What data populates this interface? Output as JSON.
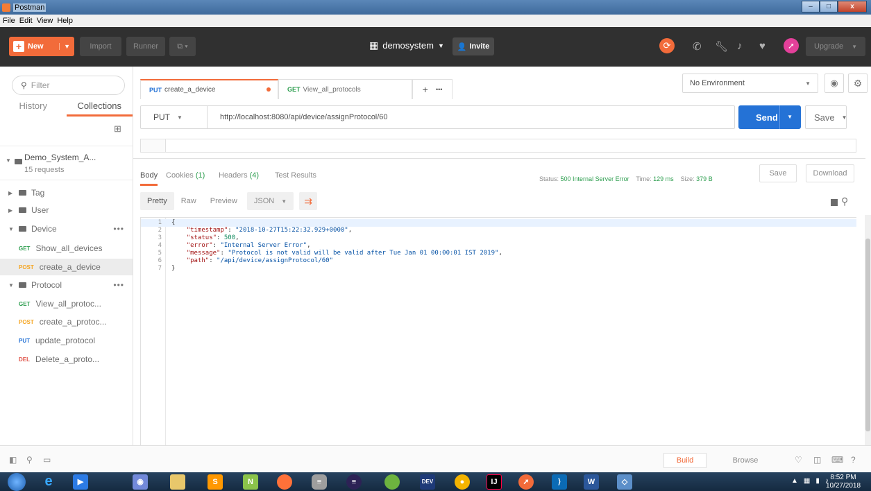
{
  "window": {
    "title": "Postman",
    "minimize": "–",
    "maximize": "□",
    "close": "x"
  },
  "menu": [
    "File",
    "Edit",
    "View",
    "Help"
  ],
  "header": {
    "new_label": "New",
    "import_label": "Import",
    "runner_label": "Runner",
    "workspace_label": "demosystem",
    "invite_label": "Invite",
    "upgrade_label": "Upgrade"
  },
  "sidebar": {
    "filter_placeholder": "Filter",
    "tabs": [
      "History",
      "Collections"
    ],
    "collection": {
      "name": "Demo_System_A...",
      "count": "15 requests"
    },
    "folders": [
      {
        "name": "Tag"
      },
      {
        "name": "User"
      },
      {
        "name": "Device",
        "more": "•••"
      },
      {
        "name": "Protocol",
        "more": "•••"
      }
    ],
    "requests": [
      {
        "method": "GET",
        "name": "Show_all_devices"
      },
      {
        "method": "POST",
        "name": "create_a_device"
      },
      {
        "method": "GET",
        "name": "View_all_protoc..."
      },
      {
        "method": "POST",
        "name": "create_a_protoc..."
      },
      {
        "method": "PUT",
        "name": "update_protocol"
      },
      {
        "method": "DEL",
        "name": "Delete_a_proto..."
      }
    ]
  },
  "tabs": [
    {
      "method": "PUT",
      "name": "create_a_device"
    },
    {
      "method": "GET",
      "name": "View_all_protocols"
    }
  ],
  "tab_more": "•••",
  "environment": "No Environment",
  "request": {
    "method": "PUT",
    "url": "http://localhost:8080/api/device/assignProtocol/60",
    "send_label": "Send",
    "save_label": "Save"
  },
  "response": {
    "tabs": {
      "body": "Body",
      "cookies": "Cookies",
      "cookies_count": "(1)",
      "headers": "Headers",
      "headers_count": "(4)",
      "tests": "Test Results"
    },
    "status_label": "Status:",
    "status_value": "500 Internal Server Error",
    "time_label": "Time:",
    "time_value": "129 ms",
    "size_label": "Size:",
    "size_value": "379 B",
    "save_label": "Save",
    "download_label": "Download",
    "views": [
      "Pretty",
      "Raw",
      "Preview"
    ],
    "format": "JSON",
    "lines": [
      {
        "n": "1",
        "text": "{"
      },
      {
        "n": "2",
        "key": "\"timestamp\"",
        "val": "\"2018-10-27T15:22:32.929+0000\"",
        "end": ","
      },
      {
        "n": "3",
        "key": "\"status\"",
        "val": "500",
        "end": ","
      },
      {
        "n": "4",
        "key": "\"error\"",
        "val": "\"Internal Server Error\"",
        "end": ","
      },
      {
        "n": "5",
        "key": "\"message\"",
        "val": "\"Protocol is not valid will be valid after Tue Jan 01 00:00:01 IST 2019\"",
        "end": ","
      },
      {
        "n": "6",
        "key": "\"path\"",
        "val": "\"/api/device/assignProtocol/60\"",
        "end": ""
      },
      {
        "n": "7",
        "text": "}"
      }
    ]
  },
  "statusbar": {
    "build_label": "Build",
    "browse_label": "Browse"
  },
  "taskbar": {
    "apps": [
      "start",
      "internet-explorer",
      "media-player",
      "discord",
      "file-explorer",
      "sublime",
      "notepad-plus",
      "firefox",
      "database",
      "eclipse",
      "spring-tools",
      "devcpp",
      "chrome",
      "intellij",
      "postman",
      "visual-studio-code",
      "word",
      "virtualbox"
    ],
    "time": "8:52 PM",
    "date": "10/27/2018"
  },
  "colors": {
    "accent": "#f26b3a",
    "send": "#2472d6",
    "header_bg": "#303030",
    "status_ok": "#2b9d4d"
  }
}
